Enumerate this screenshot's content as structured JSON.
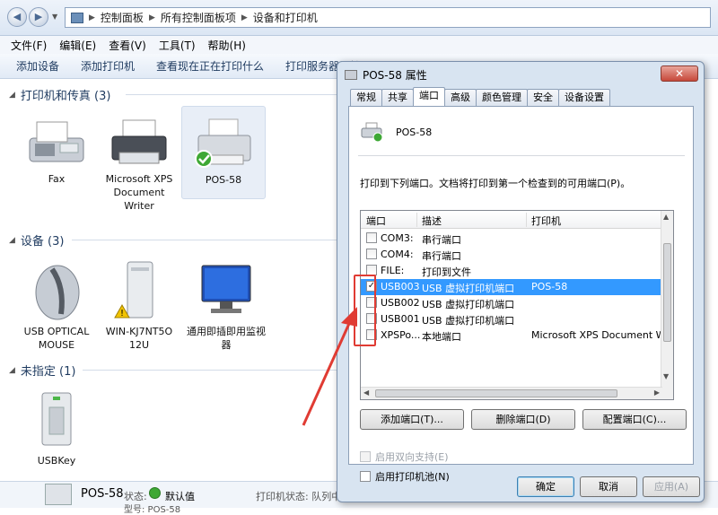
{
  "address_bar": {
    "crumbs": [
      "控制面板",
      "所有控制面板项",
      "设备和打印机"
    ]
  },
  "menu": [
    "文件(F)",
    "编辑(E)",
    "查看(V)",
    "工具(T)",
    "帮助(H)"
  ],
  "commands": [
    "添加设备",
    "添加打印机",
    "查看现在正在打印什么",
    "打印服务器属性"
  ],
  "groups": {
    "printers": "打印机和传真 (3)",
    "devices": "设备 (3)",
    "unspecified": "未指定 (1)"
  },
  "printers": [
    {
      "name": "Fax"
    },
    {
      "name": "Microsoft XPS Document Writer"
    },
    {
      "name": "POS-58"
    }
  ],
  "devices": [
    {
      "name": "USB OPTICAL MOUSE"
    },
    {
      "name": "WIN-KJ7NT5O 12U"
    },
    {
      "name": "通用即插即用监视器"
    }
  ],
  "unspecified": [
    {
      "name": "USBKey"
    }
  ],
  "status_bar": {
    "name": "POS-58",
    "state_label": "状态:",
    "state_value": "默认值",
    "printer_status_label": "打印机状态: 队列中",
    "model_label": "型号: POS-58"
  },
  "dialog": {
    "title": "POS-58 属性",
    "close": "✕",
    "tabs": [
      "常规",
      "共享",
      "端口",
      "高级",
      "颜色管理",
      "安全",
      "设备设置"
    ],
    "active_tab": "端口",
    "printer_name": "POS-58",
    "instruction": "打印到下列端口。文档将打印到第一个检查到的可用端口(P)。",
    "columns": {
      "port": "端口",
      "desc": "描述",
      "printer": "打印机"
    },
    "ports": [
      {
        "port": "COM3:",
        "desc": "串行端口",
        "printer": "",
        "checked": false,
        "selected": false
      },
      {
        "port": "COM4:",
        "desc": "串行端口",
        "printer": "",
        "checked": false,
        "selected": false
      },
      {
        "port": "FILE:",
        "desc": "打印到文件",
        "printer": "",
        "checked": false,
        "selected": false
      },
      {
        "port": "USB003",
        "desc": "USB 虚拟打印机端口",
        "printer": "POS-58",
        "checked": true,
        "selected": true
      },
      {
        "port": "USB002",
        "desc": "USB 虚拟打印机端口",
        "printer": "",
        "checked": false,
        "selected": false
      },
      {
        "port": "USB001",
        "desc": "USB 虚拟打印机端口",
        "printer": "",
        "checked": false,
        "selected": false
      },
      {
        "port": "XPSPo...",
        "desc": "本地端口",
        "printer": "Microsoft XPS Document W...",
        "checked": false,
        "selected": false
      }
    ],
    "buttons": {
      "add_port": "添加端口(T)...",
      "delete_port": "删除端口(D)",
      "config_port": "配置端口(C)..."
    },
    "bidirectional": "启用双向支持(E)",
    "pooling": "启用打印机池(N)",
    "footer": {
      "ok": "确定",
      "cancel": "取消",
      "apply": "应用(A)"
    }
  },
  "colors": {
    "accent": "#3399ff",
    "highlight_box": "#e03b33"
  }
}
